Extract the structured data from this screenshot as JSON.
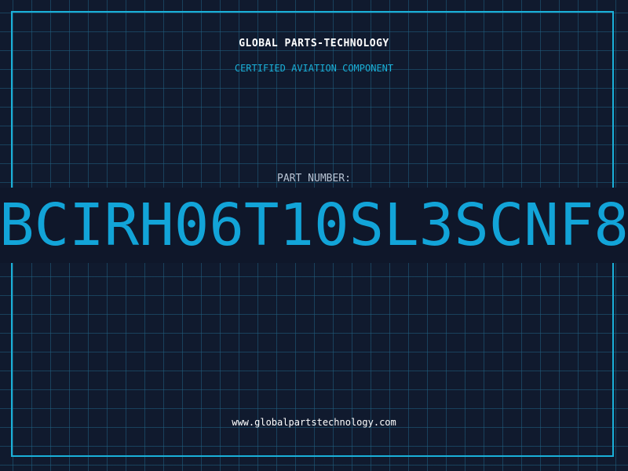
{
  "header": {
    "brand": "GLOBAL PARTS-TECHNOLOGY",
    "subtitle": "CERTIFIED AVIATION COMPONENT"
  },
  "part": {
    "label": "PART NUMBER:",
    "number": "BCIRH06T10SL3SCNF8"
  },
  "footer": {
    "url": "www.globalpartstechnology.com"
  },
  "colors": {
    "background": "#101a2e",
    "grid": "#216082",
    "accent": "#1ab0d8",
    "part_number": "#12a4d8"
  }
}
